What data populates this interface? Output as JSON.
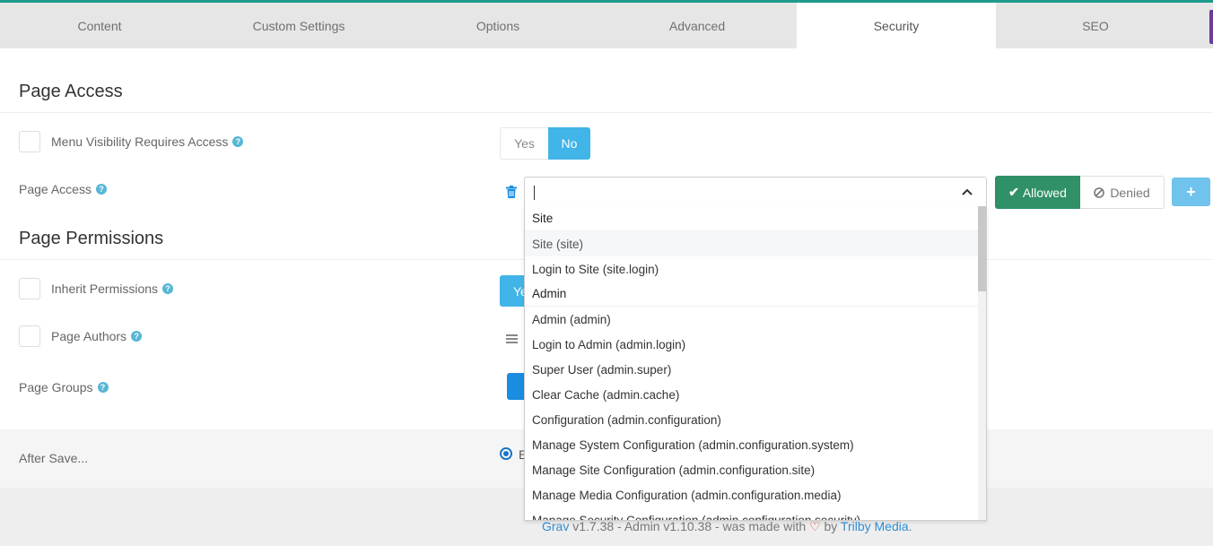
{
  "tabs": [
    {
      "label": "Content",
      "active": false
    },
    {
      "label": "Custom Settings",
      "active": false
    },
    {
      "label": "Options",
      "active": false
    },
    {
      "label": "Advanced",
      "active": false
    },
    {
      "label": "Security",
      "active": true
    },
    {
      "label": "SEO",
      "active": false
    }
  ],
  "page_access_section": {
    "title": "Page Access",
    "menu_visibility_label": "Menu Visibility Requires Access",
    "toggle": {
      "yes_label": "Yes",
      "no_label": "No",
      "selected": "No"
    },
    "page_access_label": "Page Access",
    "select_value": "",
    "allowed_label": "Allowed",
    "denied_label": "Denied",
    "add_label": "+"
  },
  "page_permissions_section": {
    "title": "Page Permissions",
    "inherit_permissions_label": "Inherit Permissions",
    "inherit_yes_partial": "Ye",
    "page_authors_label": "Page Authors",
    "page_groups_label": "Page Groups"
  },
  "after_save": {
    "label": "After Save...",
    "radio_text_partial": "E"
  },
  "footer": {
    "grav_link": "Grav",
    "grav_version": " v1.7.38 - Admin v1.10.38 - was made with ",
    "by_text": " by ",
    "trilby_link": "Trilby Media",
    "period": "."
  },
  "dropdown": {
    "items": [
      {
        "label": "Site",
        "type": "group"
      },
      {
        "label": "Site (site)",
        "type": "option",
        "hover": true
      },
      {
        "label": "Login to Site (site.login)",
        "type": "option"
      },
      {
        "label": "Admin",
        "type": "group"
      },
      {
        "label": "Admin (admin)",
        "type": "option"
      },
      {
        "label": "Login to Admin (admin.login)",
        "type": "option"
      },
      {
        "label": "Super User (admin.super)",
        "type": "option"
      },
      {
        "label": "Clear Cache (admin.cache)",
        "type": "option"
      },
      {
        "label": "Configuration (admin.configuration)",
        "type": "option"
      },
      {
        "label": "Manage System Configuration (admin.configuration.system)",
        "type": "option"
      },
      {
        "label": "Manage Site Configuration (admin.configuration.site)",
        "type": "option"
      },
      {
        "label": "Manage Media Configuration (admin.configuration.media)",
        "type": "option"
      },
      {
        "label": "Manage Security Configuration (admin.configuration.security)",
        "type": "option"
      }
    ]
  },
  "colors": {
    "accent": "#41b4e8",
    "allowed": "#309067",
    "help": "#57b7d5"
  }
}
